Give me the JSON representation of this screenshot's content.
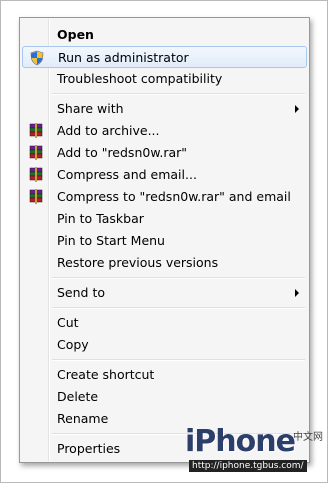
{
  "menu": {
    "items": [
      {
        "label": "Open",
        "bold": true,
        "icon": "",
        "submenu": false
      },
      {
        "label": "Run as administrator",
        "icon": "uac-shield-icon",
        "submenu": false,
        "hover": true
      },
      {
        "label": "Troubleshoot compatibility",
        "icon": "",
        "submenu": false
      },
      {
        "label": "Share with",
        "icon": "",
        "submenu": true
      },
      {
        "label": "Add to archive...",
        "icon": "winrar-icon",
        "submenu": false
      },
      {
        "label": "Add to \"redsn0w.rar\"",
        "icon": "winrar-icon",
        "submenu": false
      },
      {
        "label": "Compress and email...",
        "icon": "winrar-icon",
        "submenu": false
      },
      {
        "label": "Compress to \"redsn0w.rar\" and email",
        "icon": "winrar-icon",
        "submenu": false
      },
      {
        "label": "Pin to Taskbar",
        "icon": "",
        "submenu": false
      },
      {
        "label": "Pin to Start Menu",
        "icon": "",
        "submenu": false
      },
      {
        "label": "Restore previous versions",
        "icon": "",
        "submenu": false
      },
      {
        "label": "Send to",
        "icon": "",
        "submenu": true
      },
      {
        "label": "Cut",
        "icon": "",
        "submenu": false
      },
      {
        "label": "Copy",
        "icon": "",
        "submenu": false
      },
      {
        "label": "Create shortcut",
        "icon": "",
        "submenu": false
      },
      {
        "label": "Delete",
        "icon": "",
        "submenu": false
      },
      {
        "label": "Rename",
        "icon": "",
        "submenu": false
      },
      {
        "label": "Properties",
        "icon": "",
        "submenu": false
      }
    ]
  },
  "watermark": {
    "brand": "iPhone",
    "cn": "中文网",
    "url": "http://iphone.tgbus.com/"
  },
  "colors": {
    "hover_border": "#a9c7ee",
    "menu_bg": "#f5f5f5"
  }
}
